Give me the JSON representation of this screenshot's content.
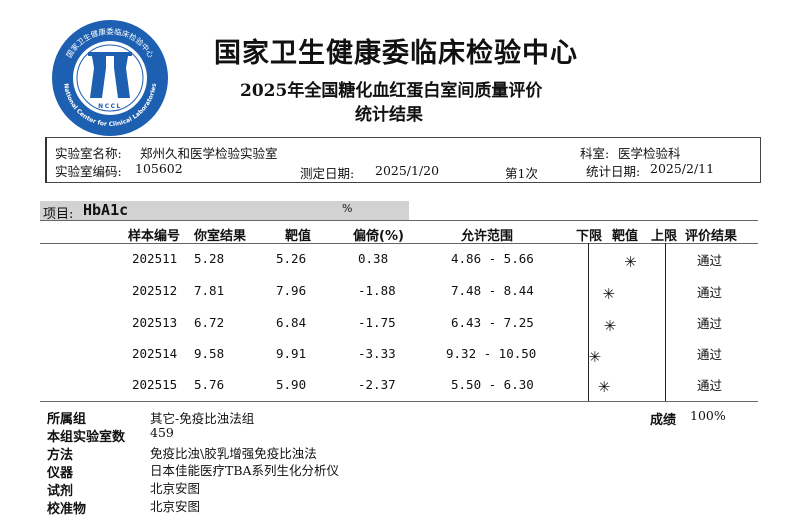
{
  "header": {
    "org_title": "国家卫生健康委临床检验中心",
    "eqa_title": "2025年全国糖化血红蛋白室间质量评价",
    "sub_title": "统计结果",
    "logo_text": "National Center for Clinical Laboratories",
    "logo_acronym": "NCCL",
    "logo_cn": "国家卫生健康委临床检验中心"
  },
  "info": {
    "lab_name_label": "实验室名称:",
    "lab_name": "郑州久和医学检验实验室",
    "dept_label": "科室:",
    "dept": "医学检验科",
    "lab_code_label": "实验室编码:",
    "lab_code": "105602",
    "test_date_label": "测定日期:",
    "test_date": "2025/1/20",
    "round": "第1次",
    "stat_date_label": "统计日期:",
    "stat_date": "2025/2/11"
  },
  "item": {
    "label": "项目:",
    "name": "HbA1c",
    "unit": "%"
  },
  "columns": {
    "sample_no": "样本编号",
    "your_result": "你室结果",
    "target": "靶值",
    "bias": "偏倚(%)",
    "range": "允许范围",
    "lower": "下限",
    "target2": "靶值",
    "upper": "上限",
    "evaluation": "评价结果"
  },
  "rows": [
    {
      "sample": "202511",
      "result": "5.28",
      "target": "5.26",
      "bias": "0.38",
      "range": "4.86 - 5.66",
      "bias_value": 0.38,
      "eval": "通过"
    },
    {
      "sample": "202512",
      "result": "7.81",
      "target": "7.96",
      "bias": "-1.88",
      "range": "7.48 - 8.44",
      "bias_value": -1.88,
      "eval": "通过"
    },
    {
      "sample": "202513",
      "result": "6.72",
      "target": "6.84",
      "bias": "-1.75",
      "range": "6.43 - 7.25",
      "bias_value": -1.75,
      "eval": "通过"
    },
    {
      "sample": "202514",
      "result": "9.58",
      "target": "9.91",
      "bias": "-3.33",
      "range": "9.32 - 10.50",
      "bias_value": -3.33,
      "eval": "通过"
    },
    {
      "sample": "202515",
      "result": "5.76",
      "target": "5.90",
      "bias": "-2.37",
      "range": "5.50 - 6.30",
      "bias_value": -2.37,
      "eval": "通过"
    }
  ],
  "marker_glyph": "✳",
  "footer": {
    "group_label": "所属组",
    "group": "其它-免疫比浊法组",
    "score_label": "成绩",
    "score": "100%",
    "lab_count_label": "本组实验室数",
    "lab_count": "459",
    "method_label": "方法",
    "method": "免疫比浊\\胶乳增强免疫比浊法",
    "instrument_label": "仪器",
    "instrument": "日本佳能医疗TBA系列生化分析仪",
    "reagent_label": "试剂",
    "reagent": "北京安图",
    "calibrator_label": "校准物",
    "calibrator": "北京安图"
  },
  "colors": {
    "logo_blue": "#1d5fb0",
    "item_bar": "#d2d2d2"
  }
}
